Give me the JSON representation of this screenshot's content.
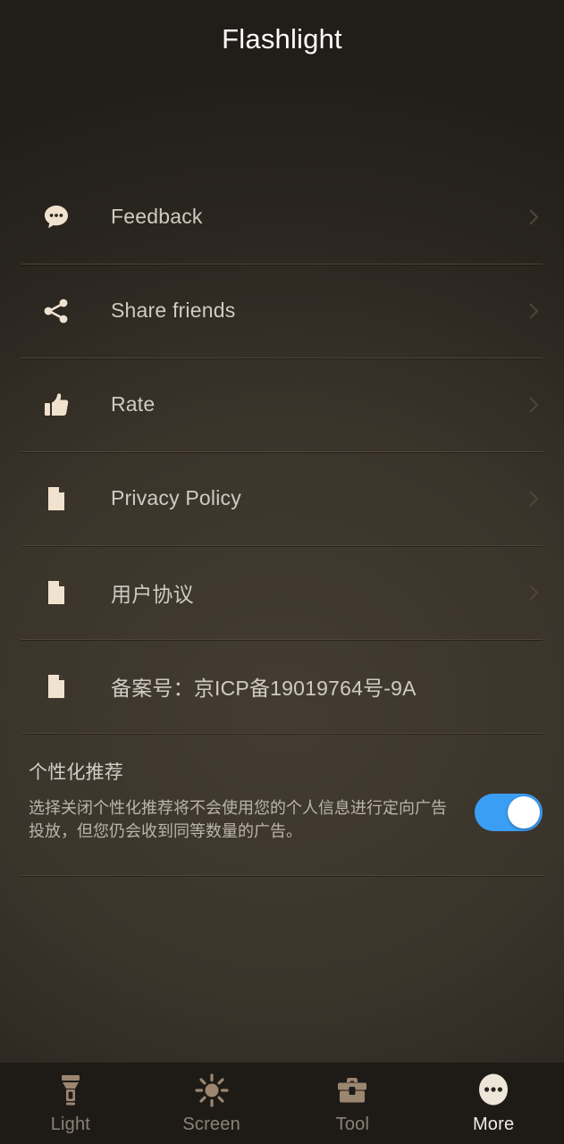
{
  "header": {
    "title": "Flashlight"
  },
  "colors": {
    "background": "#3a342b",
    "header_background": "#211e1a",
    "icon_cream": "#f0e2ce",
    "label_text": "#cfcbc3",
    "divider": "#4f4739",
    "toggle_on": "#3b9ef5",
    "toggle_knob": "#ffffff",
    "nav_background": "#1e1b17",
    "nav_inactive": "#8b8277",
    "nav_active": "#f2ece4",
    "chevron": "#4e463b"
  },
  "menu": {
    "items": [
      {
        "label": "Feedback",
        "icon": "speech-bubble-icon",
        "chevron": true
      },
      {
        "label": "Share friends",
        "icon": "share-icon",
        "chevron": true
      },
      {
        "label": "Rate",
        "icon": "thumbs-up-icon",
        "chevron": true
      },
      {
        "label": "Privacy Policy",
        "icon": "document-icon",
        "chevron": true
      },
      {
        "label": "用户协议",
        "icon": "document-icon",
        "chevron": true
      },
      {
        "label": "备案号：京ICP备19019764号-9A",
        "icon": "document-icon",
        "chevron": false
      }
    ]
  },
  "personalized": {
    "title": "个性化推荐",
    "description": "选择关闭个性化推荐将不会使用您的个人信息进行定向广告投放，但您仍会收到同等数量的广告。",
    "toggle_state": "on"
  },
  "bottom_nav": {
    "items": [
      {
        "label": "Light",
        "icon": "flashlight-icon",
        "active": false
      },
      {
        "label": "Screen",
        "icon": "sun-icon",
        "active": false
      },
      {
        "label": "Tool",
        "icon": "toolbox-icon",
        "active": false
      },
      {
        "label": "More",
        "icon": "more-dots-icon",
        "active": true
      }
    ]
  }
}
